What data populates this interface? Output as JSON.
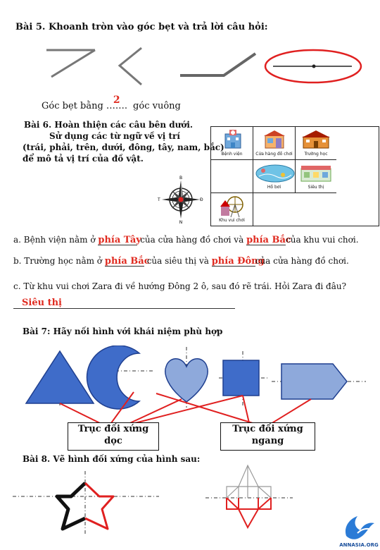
{
  "b5": {
    "title": "Bài 5. Khoanh tròn vào góc bẹt và trả lời câu hỏi:",
    "q_pre": "Góc bẹt bằng",
    "dots": "…….",
    "answer": "2",
    "q_post": "góc vuông"
  },
  "b6": {
    "title": "Bài 6. Hoàn thiện các câu bên dưới.",
    "line2": "Sử dụng các từ ngữ về vị trí",
    "line3": "(trái, phải, trên, dưới, đông, tây, nam, bắc)",
    "line4": "để mô tả vị trí của đồ vật.",
    "compass": {
      "n": "B",
      "s": "N",
      "w": "T",
      "e": "Đ"
    },
    "cells": {
      "hospital": "Bệnh viện",
      "toystore": "Cửa hàng đồ chơi",
      "school": "Trường học",
      "pool": "Hồ bơi",
      "market": "Siêu thị",
      "park": "Khu vui chơi"
    },
    "qa": {
      "pre": "a. Bệnh viện nằm ở",
      "ans1": "phía Tây",
      "mid": "của cửa hàng đồ chơi và",
      "ans2": "phía Bắc",
      "post": "của khu vui chơi."
    },
    "qb": {
      "pre": "b. Trường học nằm ở",
      "ans1": "phía Bắc",
      "mid": "của siêu thị và",
      "ans2": "phía Đông",
      "post": "của cửa hàng đồ chơi."
    },
    "qc": {
      "text": "c. Từ khu vui chơi Zara đi về hướng Đông 2 ô, sau đó rẽ trái. Hỏi Zara đi đâu?",
      "answer": "Siêu thị"
    }
  },
  "b7": {
    "title": "Bài 7: Hãy nối hình với khái niệm phù hợp",
    "box_left": [
      "Trục đối xứng",
      "dọc"
    ],
    "box_right": [
      "Trục đối xứng",
      "ngang"
    ]
  },
  "b8": {
    "title": "Bài 8. Vẽ hình đối xứng của hình sau:"
  },
  "logo": {
    "text": "ANNASIA.ORG"
  },
  "colors": {
    "answer": "#e02b20",
    "shape_blue": "#3f6cc9",
    "shape_light": "#8ea9db",
    "line_red": "#e02020"
  }
}
